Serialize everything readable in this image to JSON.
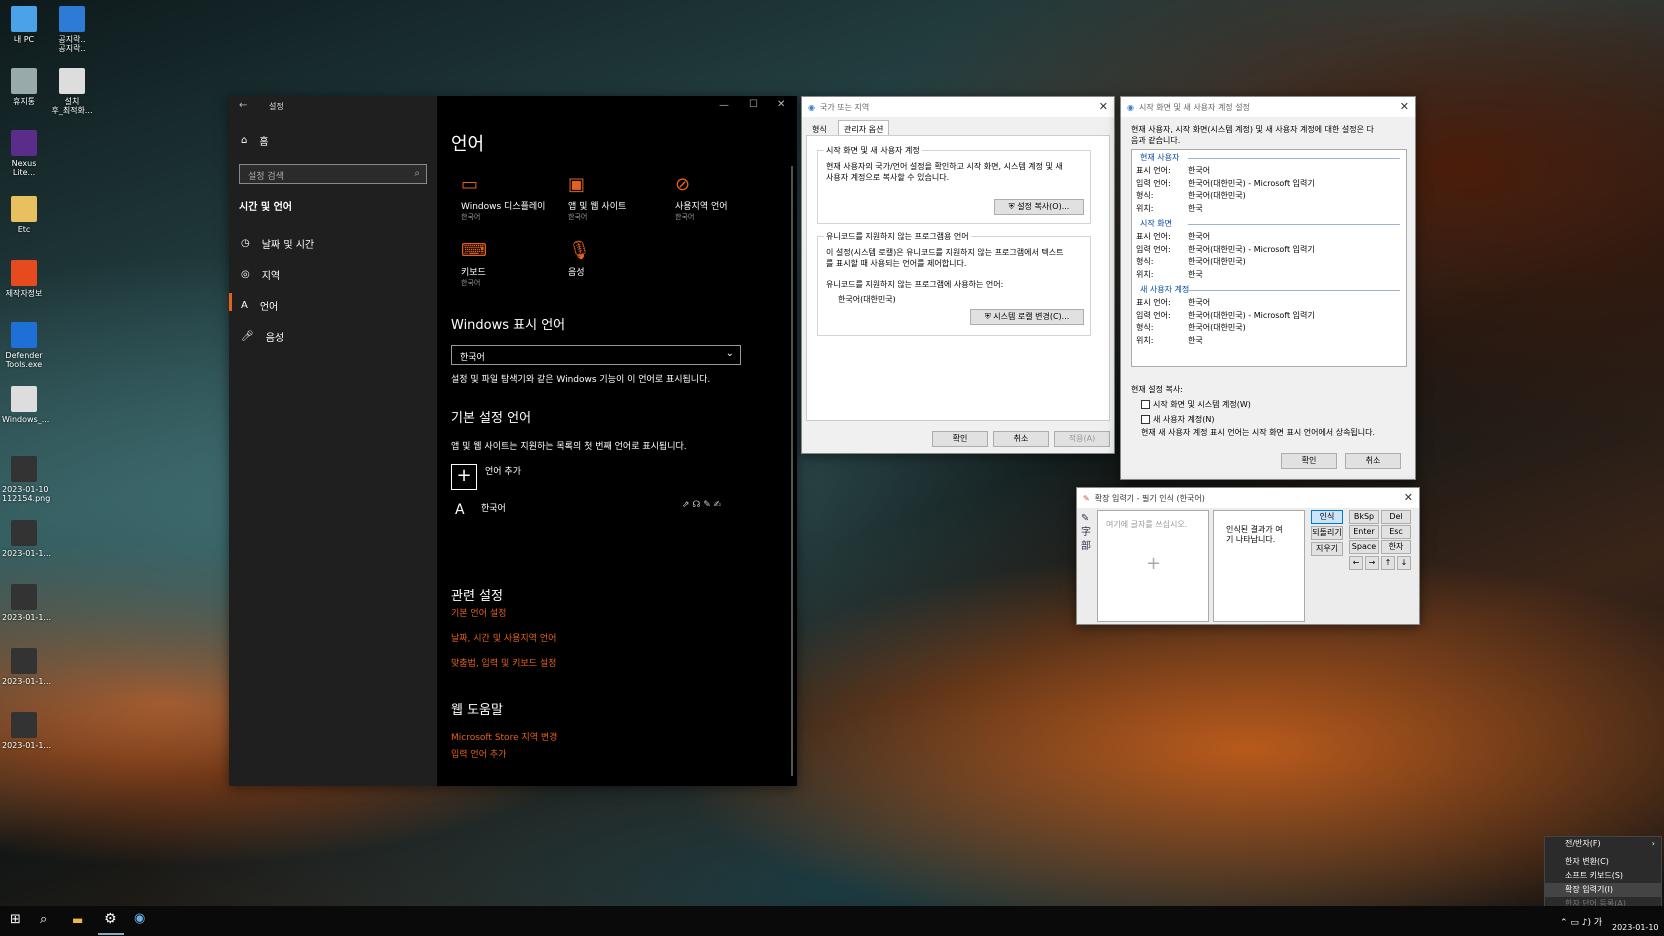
{
  "desktop": {
    "icons": [
      {
        "label": "내 PC",
        "color": "#4aa3e8"
      },
      {
        "label": "공지락..\n공지락..",
        "color": "#2e7bd6"
      },
      {
        "label": "휴지통",
        "color": "#9aa"
      },
      {
        "label": "설치\n후_최적화...",
        "color": "#ddd"
      },
      {
        "label": "Nexus\nLite...",
        "color": "#5b2d8a"
      },
      {
        "label": "Etc",
        "color": "#e8c060"
      },
      {
        "label": "제작자정보",
        "color": "#e84a20"
      },
      {
        "label": "Defender\nTools.exe",
        "color": "#1e6fd6"
      },
      {
        "label": "Windows_...",
        "color": "#ddd"
      },
      {
        "label": "2023-01-10\n112154.png",
        "color": "#333"
      },
      {
        "label": "2023-01-1...",
        "color": "#333"
      },
      {
        "label": "2023-01-1...",
        "color": "#333"
      },
      {
        "label": "2023-01-1...",
        "color": "#333"
      },
      {
        "label": "2023-01-1...",
        "color": "#333"
      }
    ]
  },
  "settings": {
    "title": "설정",
    "home": "홈",
    "search_placeholder": "설정 검색",
    "section": "시간 및 언어",
    "nav": [
      "날짜 및 시간",
      "지역",
      "언어",
      "음성"
    ],
    "heading": "언어",
    "tiles": [
      {
        "t": "Windows 디스플레이",
        "s": "한국어"
      },
      {
        "t": "앱 및 웹 사이트",
        "s": "한국어"
      },
      {
        "t": "사용지역 언어",
        "s": "한국어"
      },
      {
        "t": "키보드",
        "s": "한국어"
      },
      {
        "t": "음성",
        "s": ""
      }
    ],
    "display_lang_title": "Windows 표시 언어",
    "display_lang_value": "한국어",
    "display_lang_desc": "설정 및 파일 탐색기와 같은 Windows 기능이 이 언어로 표시됩니다.",
    "pref_title": "기본 설정 언어",
    "pref_desc": "앱 및 웹 사이트는 지원하는 목록의 첫 번째 언어로 표시됩니다.",
    "add_lang": "언어 추가",
    "lang_item": "한국어",
    "related_title": "관련 설정",
    "related": [
      "기본 언어 설정",
      "날짜, 시간 및 사용지역 언어",
      "맞춤법, 입력 및 키보드 설정"
    ],
    "help_title": "웹 도움말",
    "help": [
      "Microsoft Store 지역 변경",
      "입력 언어 추가"
    ]
  },
  "region": {
    "title": "국가 또는 지역",
    "tabs": [
      "형식",
      "관리자 옵션"
    ],
    "g1_title": "시작 화면 및 새 사용자 계정",
    "g1_text": "현재 사용자의 국가/언어 설정을 확인하고 시작 화면, 시스템 계정 및 새\n사용자 계정으로 복사할 수 있습니다.",
    "copy_btn": "설정 복사(O)...",
    "g2_title": "유니코드를 지원하지 않는 프로그램용 언어",
    "g2_text": "이 설정(시스템 로캘)은 유니코드를 지원하지 않는 프로그램에서 텍스트\n를 표시할 때 사용되는 언어를 제어합니다.",
    "g2_label": "유니코드를 지원하지 않는 프로그램에 사용하는 언어:",
    "g2_value": "한국어(대한민국)",
    "locale_btn": "시스템 로캘 변경(C)...",
    "ok": "확인",
    "cancel": "취소",
    "apply": "적용(A)"
  },
  "welcome": {
    "title": "시작 화면 및 새 사용자 계정 설정",
    "intro": "현재 사용자, 시작 화면(시스템 계정) 및 새 사용자 계정에 대한 설정은 다\n음과 같습니다.",
    "sections": [
      {
        "name": "현재 사용자",
        "rows": [
          [
            "표시 언어:",
            "한국어"
          ],
          [
            "입력 언어:",
            "한국어(대한민국) - Microsoft 입력기"
          ],
          [
            "형식:",
            "한국어(대한민국)"
          ],
          [
            "위치:",
            "한국"
          ]
        ]
      },
      {
        "name": "시작 화면",
        "rows": [
          [
            "표시 언어:",
            "한국어"
          ],
          [
            "입력 언어:",
            "한국어(대한민국) - Microsoft 입력기"
          ],
          [
            "형식:",
            "한국어(대한민국)"
          ],
          [
            "위치:",
            "한국"
          ]
        ]
      },
      {
        "name": "새 사용자 계정",
        "rows": [
          [
            "표시 언어:",
            "한국어"
          ],
          [
            "입력 언어:",
            "한국어(대한민국) - Microsoft 입력기"
          ],
          [
            "형식:",
            "한국어(대한민국)"
          ],
          [
            "위치:",
            "한국"
          ]
        ]
      }
    ],
    "copy_title": "현재 설정 복사:",
    "chk1": "시작 화면 및 시스템 계정(W)",
    "chk2": "새 사용자 계정(N)",
    "note": "현재 새 사용자 계정 표시 언어는 시작 화면 표시 언어에서 상속됩니다.",
    "ok": "확인",
    "cancel": "취소"
  },
  "ime": {
    "title": "확장 입력기 - 필기 인식 (한국어)",
    "write_hint": "여기에 글자를 쓰십시오.",
    "result_hint": "인식된 결과가 여\n기 나타납니다.",
    "btns": [
      "인식",
      "되돌리기",
      "지우기"
    ],
    "keys": [
      "BkSp",
      "Del",
      "Enter",
      "Esc",
      "Space",
      "한자"
    ],
    "arrows": [
      "←",
      "→",
      "↑",
      "↓"
    ]
  },
  "context_menu": {
    "items": [
      "전/반자(F)",
      "한자 변환(C)",
      "소프트 키보드(S)",
      "확장 입력기(I)",
      "한자 단어 등록(A)"
    ]
  },
  "taskbar": {
    "clock_date": "2023-01-10",
    "tray": "가"
  }
}
